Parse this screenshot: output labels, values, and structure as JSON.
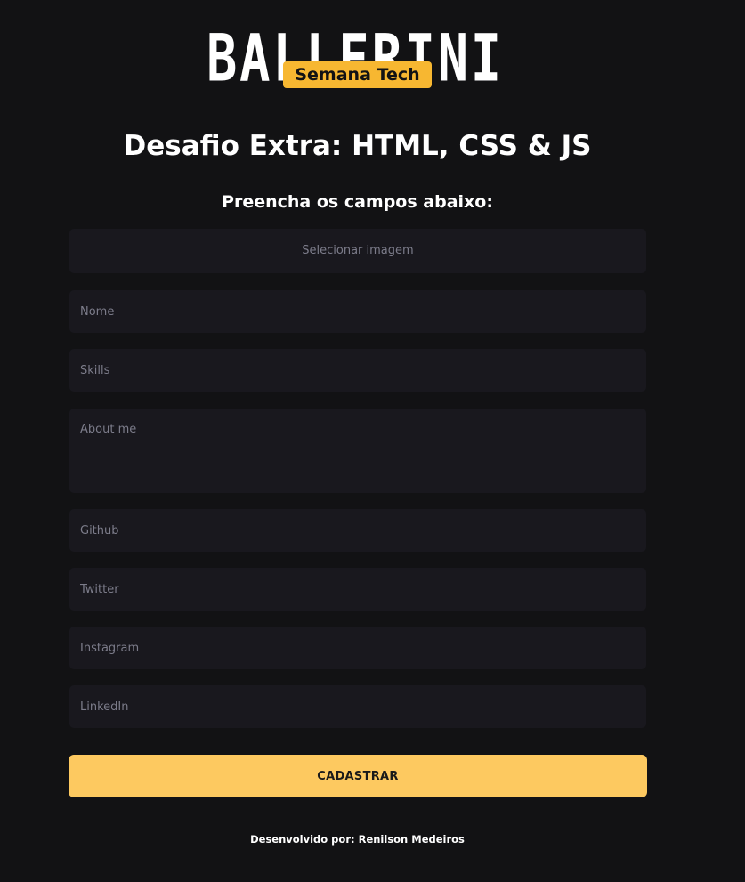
{
  "logo": {
    "wordmark": "BALLERINI",
    "badge": "Semana Tech"
  },
  "header": {
    "title": "Desafio Extra: HTML, CSS & JS",
    "subtitle": "Preencha os campos abaixo:"
  },
  "form": {
    "image_picker_label": "Selecionar imagem",
    "name_placeholder": "Nome",
    "skills_placeholder": "Skills",
    "about_placeholder": "About me",
    "github_placeholder": "Github",
    "twitter_placeholder": "Twitter",
    "instagram_placeholder": "Instagram",
    "linkedin_placeholder": "LinkedIn",
    "submit_label": "CADASTRAR"
  },
  "footer": {
    "credit": "Desenvolvido por: Renilson Medeiros"
  },
  "colors": {
    "background": "#121214",
    "field_background": "#19181e",
    "accent": "#fdc960",
    "badge": "#f7b731"
  }
}
